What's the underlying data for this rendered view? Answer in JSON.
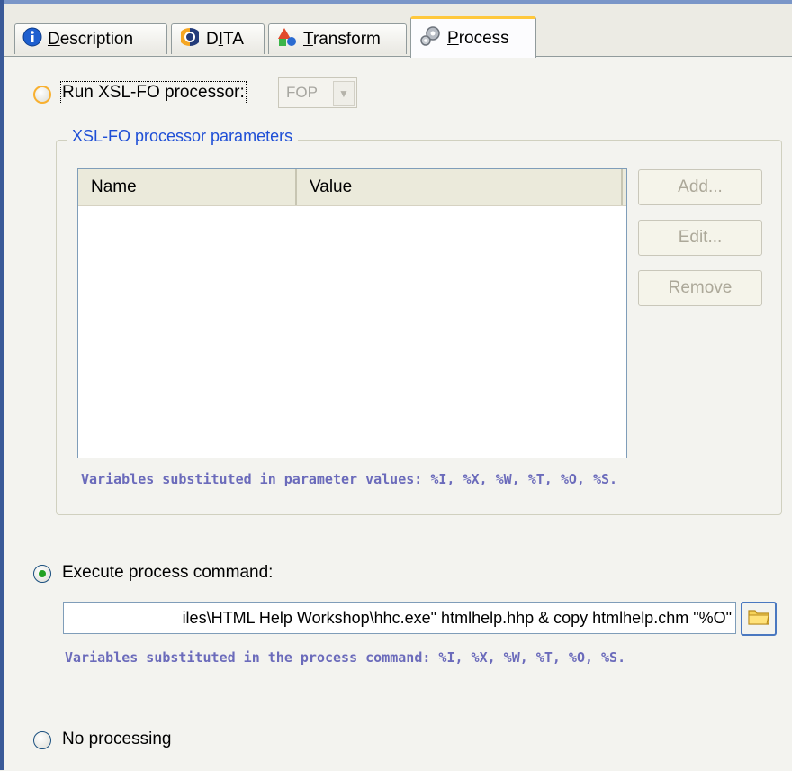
{
  "tabs": [
    {
      "label_pre": "",
      "label_ul": "D",
      "label_post": "escription",
      "icon": "info-icon"
    },
    {
      "label_pre": "D",
      "label_ul": "I",
      "label_post": "TA",
      "icon": "dita-icon"
    },
    {
      "label_pre": "",
      "label_ul": "T",
      "label_post": "ransform",
      "icon": "transform-icon"
    },
    {
      "label_pre": "",
      "label_ul": "P",
      "label_post": "rocess",
      "icon": "gears-icon"
    }
  ],
  "active_tab": "Process",
  "run_xslfo": {
    "label": "Run XSL-FO processor:",
    "processor_value": "FOP"
  },
  "group": {
    "title": "XSL-FO processor parameters",
    "columns": [
      "Name",
      "Value"
    ],
    "rows": [],
    "buttons": {
      "add": "Add...",
      "edit": "Edit...",
      "remove": "Remove"
    },
    "hint": "Variables substituted in parameter values: %I, %X, %W, %T, %O, %S."
  },
  "execute": {
    "label": "Execute process command:",
    "command_value": "iles\\HTML Help Workshop\\hhc.exe\" htmlhelp.hhp & copy htmlhelp.chm \"%O\"",
    "hint": "Variables substituted in the process command: %I, %X, %W, %T, %O, %S."
  },
  "no_processing": {
    "label": "No processing"
  },
  "selected_option": "Execute process command"
}
